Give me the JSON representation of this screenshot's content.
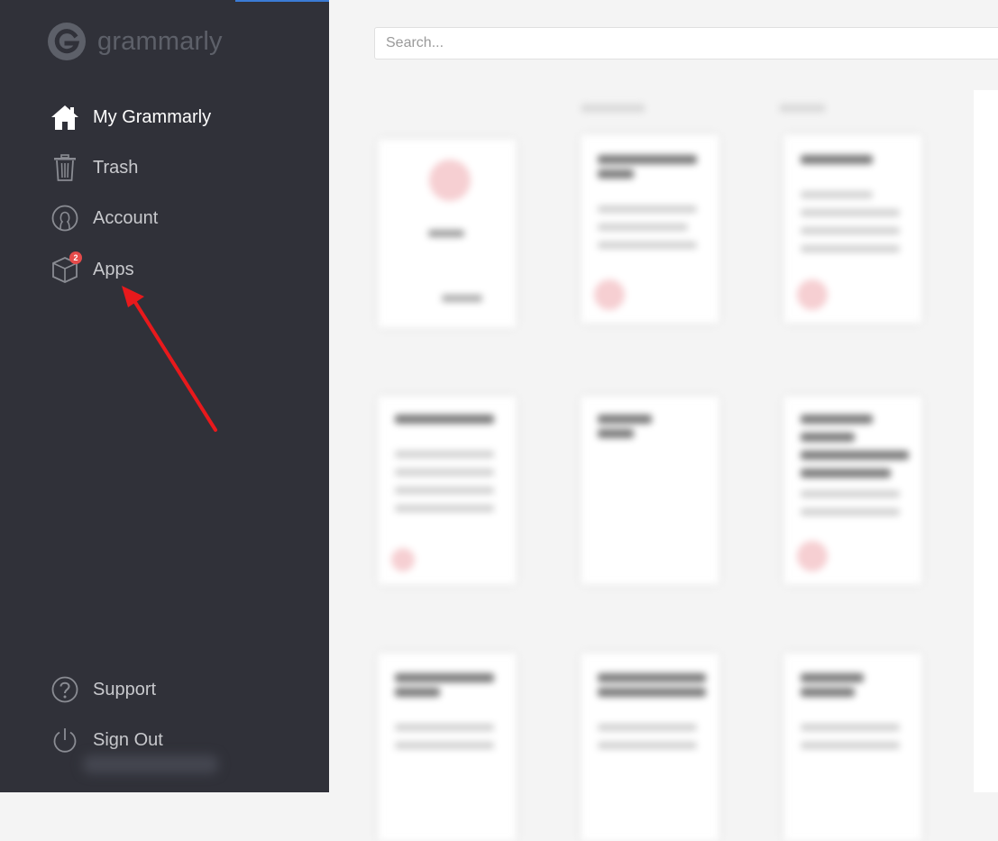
{
  "brand": {
    "name": "grammarly"
  },
  "nav": {
    "items": [
      {
        "label": "My Grammarly",
        "icon": "home-icon",
        "active": true
      },
      {
        "label": "Trash",
        "icon": "trash-icon",
        "active": false
      },
      {
        "label": "Account",
        "icon": "account-icon",
        "active": false
      },
      {
        "label": "Apps",
        "icon": "box-icon",
        "active": false,
        "badge": "2"
      }
    ],
    "bottom": [
      {
        "label": "Support",
        "icon": "question-icon"
      },
      {
        "label": "Sign Out",
        "icon": "power-icon"
      }
    ]
  },
  "search": {
    "placeholder": "Search..."
  },
  "colors": {
    "sidebar_bg": "#303139",
    "main_bg": "#f4f4f4",
    "badge": "#e54b4b",
    "annotation_arrow": "#e8191c"
  }
}
